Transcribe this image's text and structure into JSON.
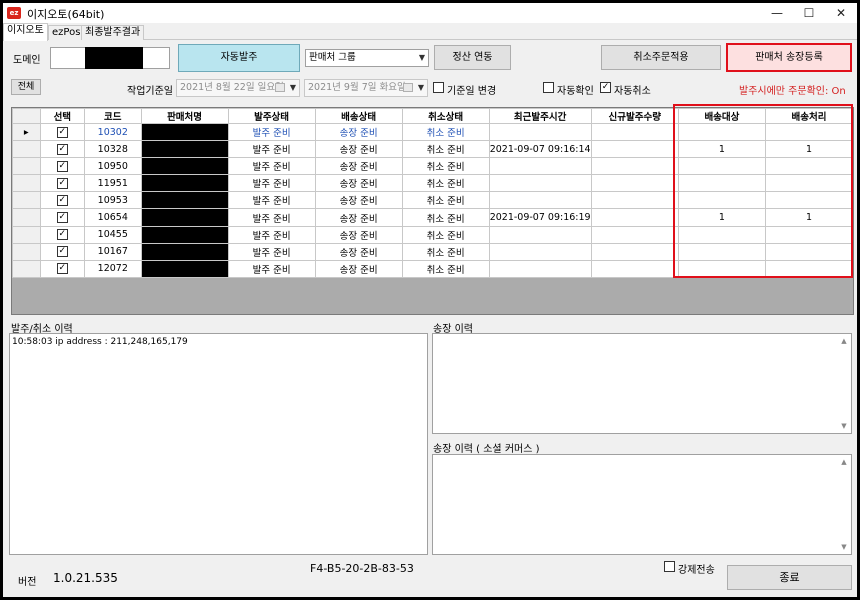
{
  "window": {
    "title": "이지오토(64bit)",
    "app_icon": "ez"
  },
  "tabs": [
    {
      "label": "이지오토"
    },
    {
      "label": "ezPos"
    },
    {
      "label": "최종발주결과"
    }
  ],
  "toolbar": {
    "domain_label": "도메인",
    "auto_order_button": "자동발주",
    "vendor_group_select": "판매처 그룹",
    "settlement_button": "정산 연동",
    "cancel_apply_button": "취소주문적용",
    "vendor_invoice_button": "판매처 송장등록",
    "all_button": "전체",
    "work_date_label": "작업기준일",
    "date_from": "2021년   8월 22일 일요일",
    "date_to": "2021년   9월   7일 화요일",
    "base_date_change_label": "기준일 변경",
    "auto_confirm_label": "자동확인",
    "auto_cancel_label": "자동취소",
    "order_confirm_status": "발주시에만 주문확인: On"
  },
  "table": {
    "headers": [
      "선택",
      "코드",
      "판매처명",
      "발주상태",
      "배송상태",
      "취소상태",
      "최근발주시간",
      "신규발주수량",
      "배송대상",
      "배송처리"
    ],
    "rows": [
      {
        "code": "10302",
        "order": "발주 준비",
        "ship": "송장 준비",
        "cancel": "취소 준비",
        "time": "",
        "qty": "",
        "target": "",
        "processed": ""
      },
      {
        "code": "10328",
        "order": "발주 준비",
        "ship": "송장 준비",
        "cancel": "취소 준비",
        "time": "2021-09-07 09:16:14",
        "qty": "",
        "target": "1",
        "processed": "1"
      },
      {
        "code": "10950",
        "order": "발주 준비",
        "ship": "송장 준비",
        "cancel": "취소 준비",
        "time": "",
        "qty": "",
        "target": "",
        "processed": ""
      },
      {
        "code": "11951",
        "order": "발주 준비",
        "ship": "송장 준비",
        "cancel": "취소 준비",
        "time": "",
        "qty": "",
        "target": "",
        "processed": ""
      },
      {
        "code": "10953",
        "order": "발주 준비",
        "ship": "송장 준비",
        "cancel": "취소 준비",
        "time": "",
        "qty": "",
        "target": "",
        "processed": ""
      },
      {
        "code": "10654",
        "order": "발주 준비",
        "ship": "송장 준비",
        "cancel": "취소 준비",
        "time": "2021-09-07 09:16:19",
        "qty": "",
        "target": "1",
        "processed": "1"
      },
      {
        "code": "10455",
        "order": "발주 준비",
        "ship": "송장 준비",
        "cancel": "취소 준비",
        "time": "",
        "qty": "",
        "target": "",
        "processed": ""
      },
      {
        "code": "10167",
        "order": "발주 준비",
        "ship": "송장 준비",
        "cancel": "취소 준비",
        "time": "",
        "qty": "",
        "target": "",
        "processed": ""
      },
      {
        "code": "12072",
        "order": "발주 준비",
        "ship": "송장 준비",
        "cancel": "취소 준비",
        "time": "",
        "qty": "",
        "target": "",
        "processed": ""
      }
    ]
  },
  "logs": {
    "order_cancel_title": "발주/취소 이력",
    "order_cancel_text": "10:58:03 ip address : 211,248,165,179",
    "invoice_title": "송장 이력",
    "invoice_social_title": "송장 이력 ( 소셜 커머스 )"
  },
  "footer": {
    "version_label": "버전",
    "version_value": "1.0.21.535",
    "mac_address": "F4-B5-20-2B-83-53",
    "force_send_label": "강제전송",
    "exit_button": "종료"
  },
  "colors": {
    "highlight_red": "#e0101b",
    "accent_teal": "#b9e5ef",
    "link_blue": "#1e4fb4"
  }
}
